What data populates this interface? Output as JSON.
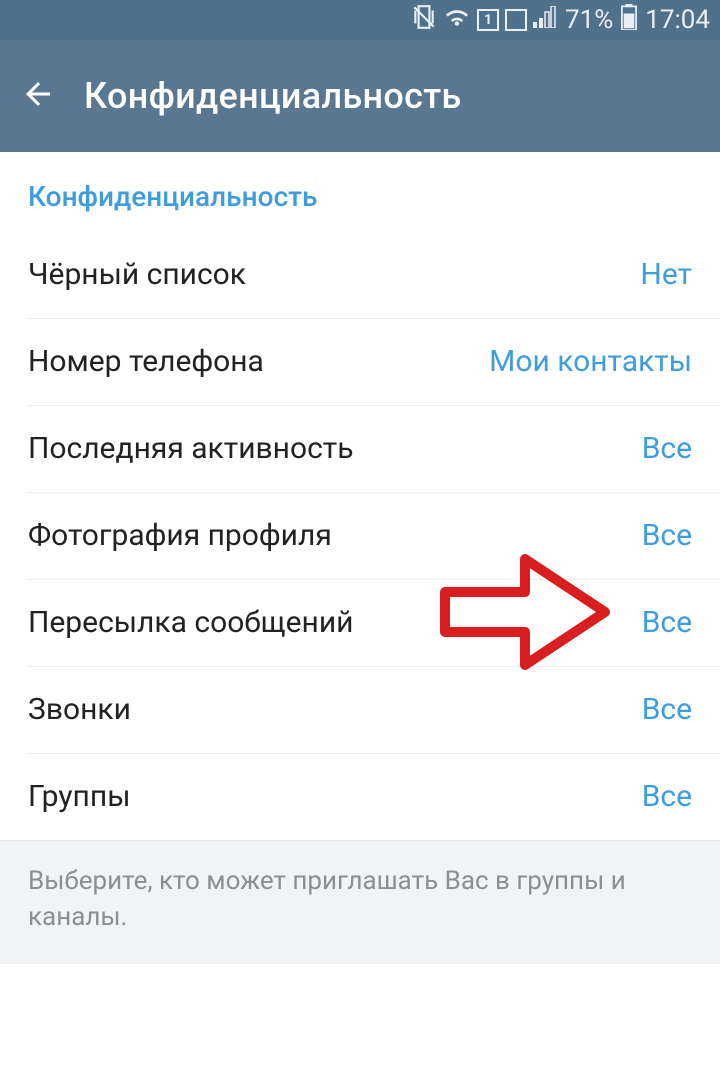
{
  "status": {
    "sim": "1",
    "battery_pct": "71%",
    "time": "17:04"
  },
  "header": {
    "title": "Конфиденциальность"
  },
  "section": {
    "title": "Конфиденциальность"
  },
  "rows": [
    {
      "label": "Чёрный список",
      "value": "Нет"
    },
    {
      "label": "Номер телефона",
      "value": "Мои контакты"
    },
    {
      "label": "Последняя активность",
      "value": "Все"
    },
    {
      "label": "Фотография профиля",
      "value": "Все"
    },
    {
      "label": "Пересылка сообщений",
      "value": "Все"
    },
    {
      "label": "Звонки",
      "value": "Все"
    },
    {
      "label": "Группы",
      "value": "Все"
    }
  ],
  "footer": {
    "note": "Выберите, кто может приглашать Вас в группы и каналы."
  }
}
